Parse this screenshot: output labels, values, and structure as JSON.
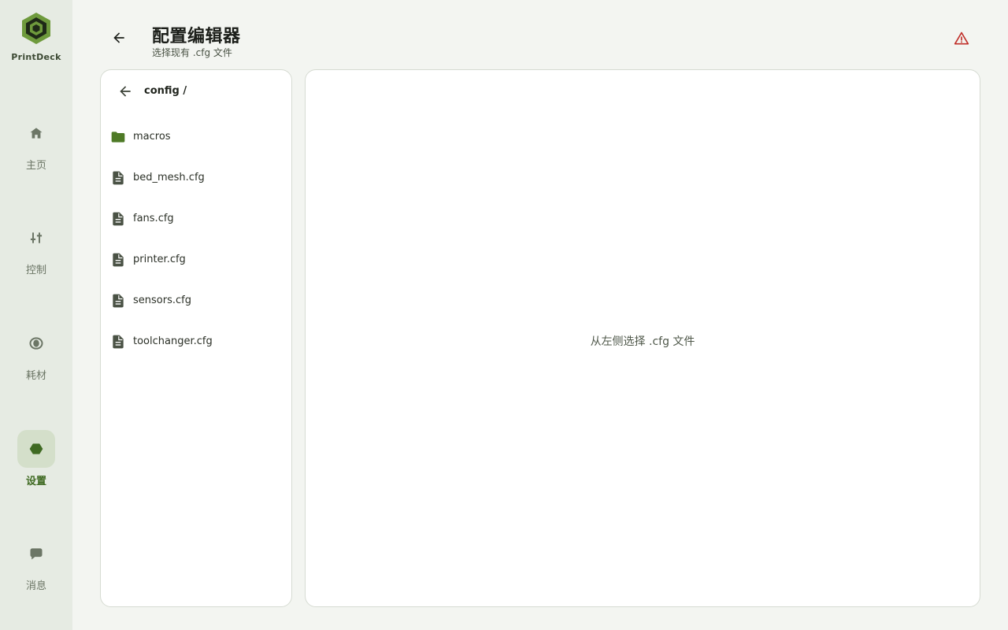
{
  "brand": {
    "name": "PrintDeck"
  },
  "nav": {
    "items": [
      {
        "label": "主页",
        "icon": "home-icon",
        "active": false
      },
      {
        "label": "控制",
        "icon": "sliders-icon",
        "active": false
      },
      {
        "label": "耗材",
        "icon": "spool-icon",
        "active": false
      },
      {
        "label": "设置",
        "icon": "hexagon-icon",
        "active": true
      },
      {
        "label": "消息",
        "icon": "chat-icon",
        "active": false
      }
    ]
  },
  "header": {
    "title": "配置编辑器",
    "subtitle": "选择现有 .cfg 文件",
    "warning_icon": "warning-icon"
  },
  "file_browser": {
    "path": "config /",
    "files": [
      {
        "name": "macros",
        "type": "folder",
        "icon": "folder-icon"
      },
      {
        "name": "bed_mesh.cfg",
        "type": "file",
        "icon": "file-icon"
      },
      {
        "name": "fans.cfg",
        "type": "file",
        "icon": "file-icon"
      },
      {
        "name": "printer.cfg",
        "type": "file",
        "icon": "file-icon"
      },
      {
        "name": "sensors.cfg",
        "type": "file",
        "icon": "file-icon"
      },
      {
        "name": "toolchanger.cfg",
        "type": "file",
        "icon": "file-icon"
      }
    ]
  },
  "editor": {
    "empty_hint": "从左侧选择 .cfg 文件"
  },
  "colors": {
    "accent": "#3f6a22",
    "folder": "#4e7a26",
    "warning": "#c0302a",
    "sidebar_bg": "#e6ebe3",
    "active_nav_bg": "#d4dfca"
  }
}
